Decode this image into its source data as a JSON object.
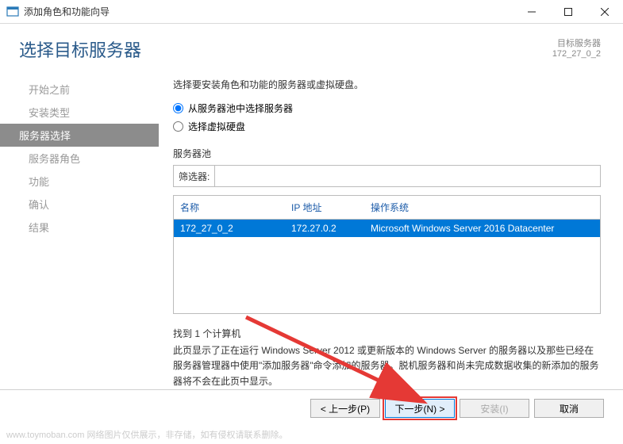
{
  "window": {
    "title": "添加角色和功能向导"
  },
  "header": {
    "heading": "选择目标服务器",
    "target_label": "目标服务器",
    "target_value": "172_27_0_2"
  },
  "sidebar": {
    "items": [
      {
        "label": "开始之前"
      },
      {
        "label": "安装类型"
      },
      {
        "label": "服务器选择",
        "active": true
      },
      {
        "label": "服务器角色"
      },
      {
        "label": "功能"
      },
      {
        "label": "确认"
      },
      {
        "label": "结果"
      }
    ]
  },
  "main": {
    "instruction": "选择要安装角色和功能的服务器或虚拟硬盘。",
    "radio_pool": "从服务器池中选择服务器",
    "radio_vhd": "选择虚拟硬盘",
    "pool_label": "服务器池",
    "filter_label": "筛选器:",
    "filter_value": "",
    "columns": {
      "name": "名称",
      "ip": "IP 地址",
      "os": "操作系统"
    },
    "rows": [
      {
        "name": "172_27_0_2",
        "ip": "172.27.0.2",
        "os": "Microsoft Windows Server 2016 Datacenter"
      }
    ],
    "count_text": "找到 1 个计算机",
    "note": "此页显示了正在运行 Windows Server 2012 或更新版本的 Windows Server 的服务器以及那些已经在服务器管理器中使用\"添加服务器\"命令添加的服务器。脱机服务器和尚未完成数据收集的新添加的服务器将不会在此页中显示。"
  },
  "buttons": {
    "prev": "< 上一步(P)",
    "next": "下一步(N) >",
    "install": "安装(I)",
    "cancel": "取消"
  },
  "watermark": "www.toymoban.com  网络图片仅供展示，非存储，如有侵权请联系删除。"
}
